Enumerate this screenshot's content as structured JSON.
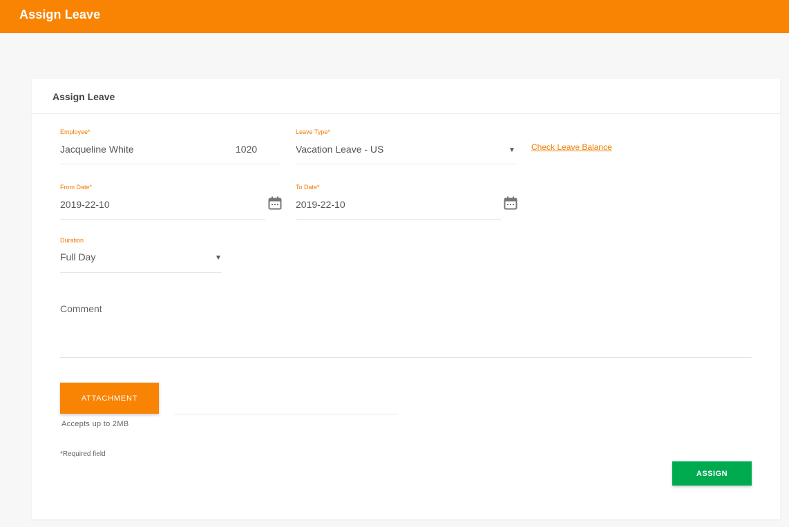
{
  "header": {
    "title": "Assign Leave"
  },
  "card": {
    "title": "Assign Leave"
  },
  "form": {
    "employee": {
      "label": "Employee",
      "required_mark": "*",
      "name": "Jacqueline White",
      "id": "1020"
    },
    "leave_type": {
      "label": "Leave Type",
      "required_mark": "*",
      "value": "Vacation Leave - US"
    },
    "check_balance": {
      "label": "Check Leave Balance"
    },
    "from_date": {
      "label": "From Date",
      "required_mark": "*",
      "value": "2019-22-10"
    },
    "to_date": {
      "label": "To Date",
      "required_mark": "*",
      "value": "2019-22-10"
    },
    "duration": {
      "label": "Duration",
      "value": "Full Day"
    },
    "comment": {
      "placeholder": "Comment"
    },
    "attachment": {
      "button_label": "ATTACHMENT",
      "hint": "Accepts up to 2MB"
    },
    "required_note": "*Required field",
    "submit": {
      "label": "ASSIGN"
    }
  },
  "icons": {
    "dropdown": "caret-down-icon",
    "date": "calendar-icon"
  },
  "colors": {
    "accent": "#f98303",
    "label": "#f07c00",
    "submit": "#00ab4f"
  }
}
